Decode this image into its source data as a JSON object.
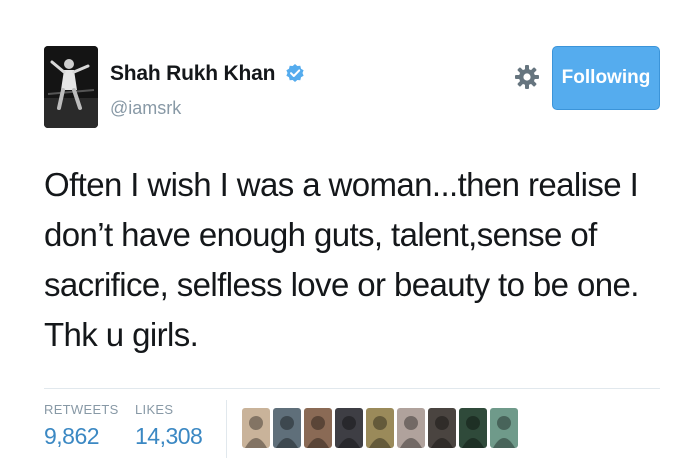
{
  "user": {
    "name": "Shah Rukh Khan",
    "handle": "@iamsrk",
    "avatar": "avatar-image",
    "verified_icon": "verified-badge-icon"
  },
  "actions": {
    "settings_icon": "gear-icon",
    "follow_label": "Following"
  },
  "tweet": {
    "text": "Often I wish I was a woman...then realise I don’t have enough guts, talent,sense of sacrifice, selfless love or beauty to be one. Thk u girls."
  },
  "stats": {
    "retweets": {
      "label": "RETWEETS",
      "value": "9,862"
    },
    "likes": {
      "label": "LIKES",
      "value": "14,308"
    }
  },
  "likers": [
    {
      "icon": "liker-avatar",
      "color": "#c9b39a"
    },
    {
      "icon": "liker-avatar",
      "color": "#5f6f7a"
    },
    {
      "icon": "liker-avatar",
      "color": "#8a6a55"
    },
    {
      "icon": "liker-avatar",
      "color": "#3e3e44"
    },
    {
      "icon": "liker-avatar",
      "color": "#9a8a5a"
    },
    {
      "icon": "liker-avatar",
      "color": "#b0a29c"
    },
    {
      "icon": "liker-avatar",
      "color": "#4a4440"
    },
    {
      "icon": "liker-avatar",
      "color": "#2f4a3a"
    },
    {
      "icon": "liker-avatar",
      "color": "#6f9a8a"
    }
  ],
  "colors": {
    "accent": "#55acee",
    "stat_value": "#3b88c3",
    "muted": "#8899a6",
    "text": "#14171a"
  }
}
